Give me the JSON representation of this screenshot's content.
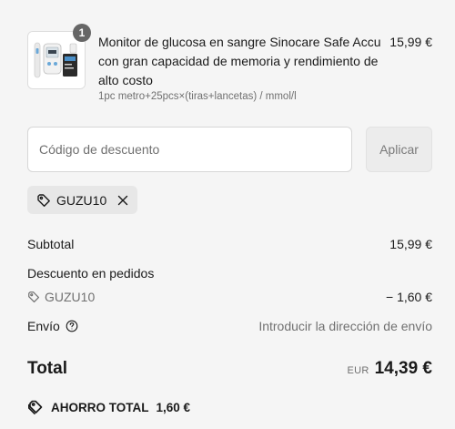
{
  "product": {
    "quantity": "1",
    "title": "Monitor de glucosa en sangre Sinocare Safe Accu con gran capacidad de memoria y rendimiento de alto costo",
    "variant": "1pc metro+25pcs×(tiras+lancetas) / mmol/l",
    "price": "15,99 €",
    "image_icon": "glucose-meter-product-image"
  },
  "discount": {
    "placeholder": "Código de descuento",
    "value": "",
    "apply_label": "Aplicar",
    "applied_code": "GUZU10"
  },
  "summary": {
    "subtotal_label": "Subtotal",
    "subtotal_value": "15,99 €",
    "discount_label": "Descuento en pedidos",
    "discount_code": "GUZU10",
    "discount_value": "− 1,60 €",
    "shipping_label": "Envío",
    "shipping_value": "Introducir la dirección de envío",
    "total_label": "Total",
    "currency": "EUR",
    "total_value": "14,39 €",
    "savings_label": "AHORRO TOTAL",
    "savings_value": "1,60 €"
  },
  "colors": {
    "background": "#f5f5f5",
    "text": "#1a1a1a",
    "muted": "#707070",
    "badge": "#666666"
  }
}
